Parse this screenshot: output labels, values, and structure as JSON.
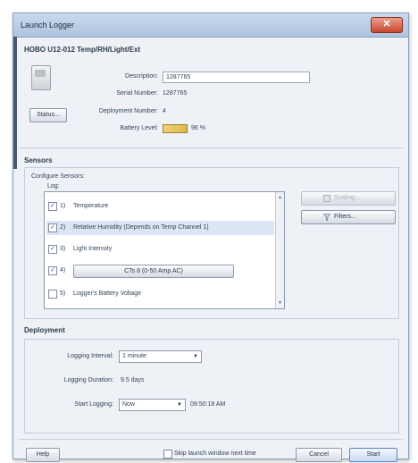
{
  "window": {
    "title": "Launch Logger",
    "close_glyph": "✕"
  },
  "device": {
    "title": "HOBO U12-012 Temp/RH/Light/Ext",
    "description_label": "Description:",
    "description_value": "1287765",
    "serial_label": "Serial Number:",
    "serial_value": "1287765",
    "deployment_label": "Deployment Number:",
    "deployment_value": "4",
    "battery_label": "Battery Level:",
    "battery_value": "96 %",
    "battery_level": 0.96,
    "status_button": "Status..."
  },
  "sensors": {
    "section_title": "Sensors",
    "configure_label": "Configure Sensors:",
    "log_label": "Log:",
    "items": [
      {
        "checked": true,
        "number": "1)",
        "name": "Temperature"
      },
      {
        "checked": true,
        "number": "2)",
        "name": "Relative Humidity (Depends on Temp Channel 1)"
      },
      {
        "checked": true,
        "number": "3)",
        "name": "Light Intensity"
      },
      {
        "checked": true,
        "number": "4)",
        "name": "CTs 8 (0-50 Amp AC)"
      },
      {
        "checked": false,
        "number": "5)",
        "name": "Logger's Battery Voltage"
      }
    ],
    "scaling_button": "Scaling...",
    "filters_button": "Filters..."
  },
  "deployment": {
    "section_title": "Deployment",
    "interval_label": "Logging Interval:",
    "interval_value": "1 minute",
    "duration_label": "Logging Duration:",
    "duration_value": "9.5 days",
    "start_label": "Start Logging:",
    "start_value": "Now",
    "start_time": "09:50:18 AM"
  },
  "footer": {
    "help_button": "Help",
    "skip_label": "Skip launch window next time",
    "cancel_button": "Cancel",
    "start_button": "Start"
  },
  "colors": {
    "accent": "#5a86c0",
    "close": "#c9462e",
    "battery": "#e0b848"
  }
}
